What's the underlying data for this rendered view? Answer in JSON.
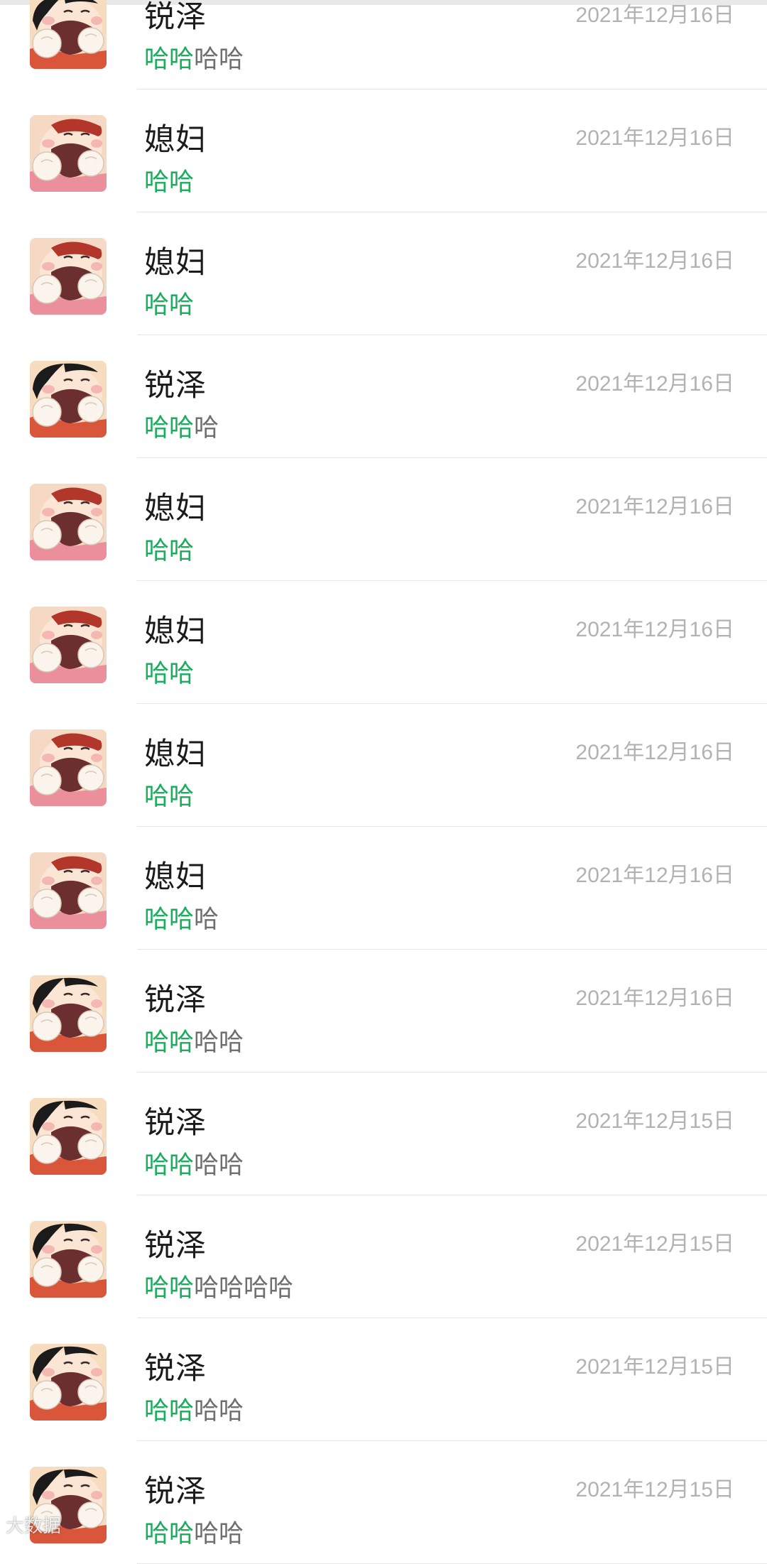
{
  "colors": {
    "highlight": "#1aad5c",
    "message_rest": "#6f6f6f",
    "name": "#1b1b1b",
    "date": "#b2b2b2",
    "divider": "#e6e6e6"
  },
  "chat_list": [
    {
      "name": "锐泽",
      "avatar": "boy-avatar",
      "highlight": "哈哈",
      "rest": "哈哈",
      "date": "2021年12月16日"
    },
    {
      "name": "媳妇",
      "avatar": "girl-avatar",
      "highlight": "哈哈",
      "rest": "",
      "date": "2021年12月16日"
    },
    {
      "name": "媳妇",
      "avatar": "girl-avatar",
      "highlight": "哈哈",
      "rest": "",
      "date": "2021年12月16日"
    },
    {
      "name": "锐泽",
      "avatar": "boy-avatar",
      "highlight": "哈哈",
      "rest": "哈",
      "date": "2021年12月16日"
    },
    {
      "name": "媳妇",
      "avatar": "girl-avatar",
      "highlight": "哈哈",
      "rest": "",
      "date": "2021年12月16日"
    },
    {
      "name": "媳妇",
      "avatar": "girl-avatar",
      "highlight": "哈哈",
      "rest": "",
      "date": "2021年12月16日"
    },
    {
      "name": "媳妇",
      "avatar": "girl-avatar",
      "highlight": "哈哈",
      "rest": "",
      "date": "2021年12月16日"
    },
    {
      "name": "媳妇",
      "avatar": "girl-avatar",
      "highlight": "哈哈",
      "rest": "哈",
      "date": "2021年12月16日"
    },
    {
      "name": "锐泽",
      "avatar": "boy-avatar",
      "highlight": "哈哈",
      "rest": "哈哈",
      "date": "2021年12月16日"
    },
    {
      "name": "锐泽",
      "avatar": "boy-avatar",
      "highlight": "哈哈",
      "rest": "哈哈",
      "date": "2021年12月15日"
    },
    {
      "name": "锐泽",
      "avatar": "boy-avatar",
      "highlight": "哈哈",
      "rest": "哈哈哈哈",
      "date": "2021年12月15日"
    },
    {
      "name": "锐泽",
      "avatar": "boy-avatar",
      "highlight": "哈哈",
      "rest": "哈哈",
      "date": "2021年12月15日"
    },
    {
      "name": "锐泽",
      "avatar": "boy-avatar",
      "highlight": "哈哈",
      "rest": "哈哈",
      "date": "2021年12月15日"
    }
  ],
  "watermark": "大数据"
}
